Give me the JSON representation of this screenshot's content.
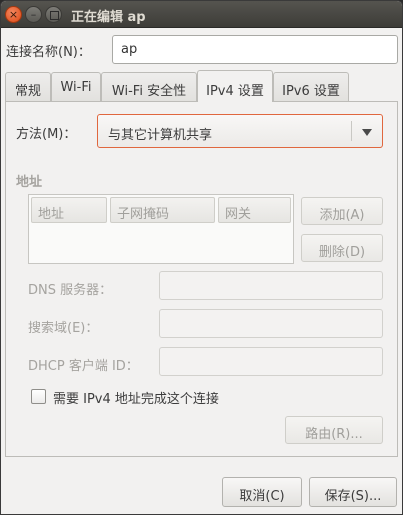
{
  "window": {
    "title": "正在编辑 ap",
    "close_glyph": "×",
    "minimize_glyph": "–"
  },
  "connection": {
    "label": "连接名称(N)：",
    "value": "ap"
  },
  "tabs": [
    {
      "label": "常规",
      "active": false
    },
    {
      "label": "Wi-Fi",
      "active": false
    },
    {
      "label": "Wi-Fi 安全性",
      "active": false
    },
    {
      "label": "IPv4 设置",
      "active": true
    },
    {
      "label": "IPv6 设置",
      "active": false
    }
  ],
  "ipv4": {
    "method_label": "方法(M)：",
    "method_value": "与其它计算机共享",
    "address_section": "地址",
    "address_columns": [
      "地址",
      "子网掩码",
      "网关"
    ],
    "add_button": "添加(A)",
    "delete_button": "删除(D)",
    "dns_label": "DNS 服务器：",
    "dns_value": "",
    "search_label": "搜索域(E)：",
    "search_value": "",
    "dhcp_label": "DHCP 客户端 ID：",
    "dhcp_value": "",
    "require_checkbox_label": "需要 IPv4 地址完成这个连接",
    "require_checked": false,
    "routes_button": "路由(R)..."
  },
  "footer": {
    "cancel_button": "取消(C)",
    "save_button": "保存(S)..."
  },
  "colors": {
    "accent": "#dd4814",
    "window_bg": "#f2f1f0",
    "titlebar": "#3d3c38",
    "disabled_text": "#a5a39f"
  }
}
